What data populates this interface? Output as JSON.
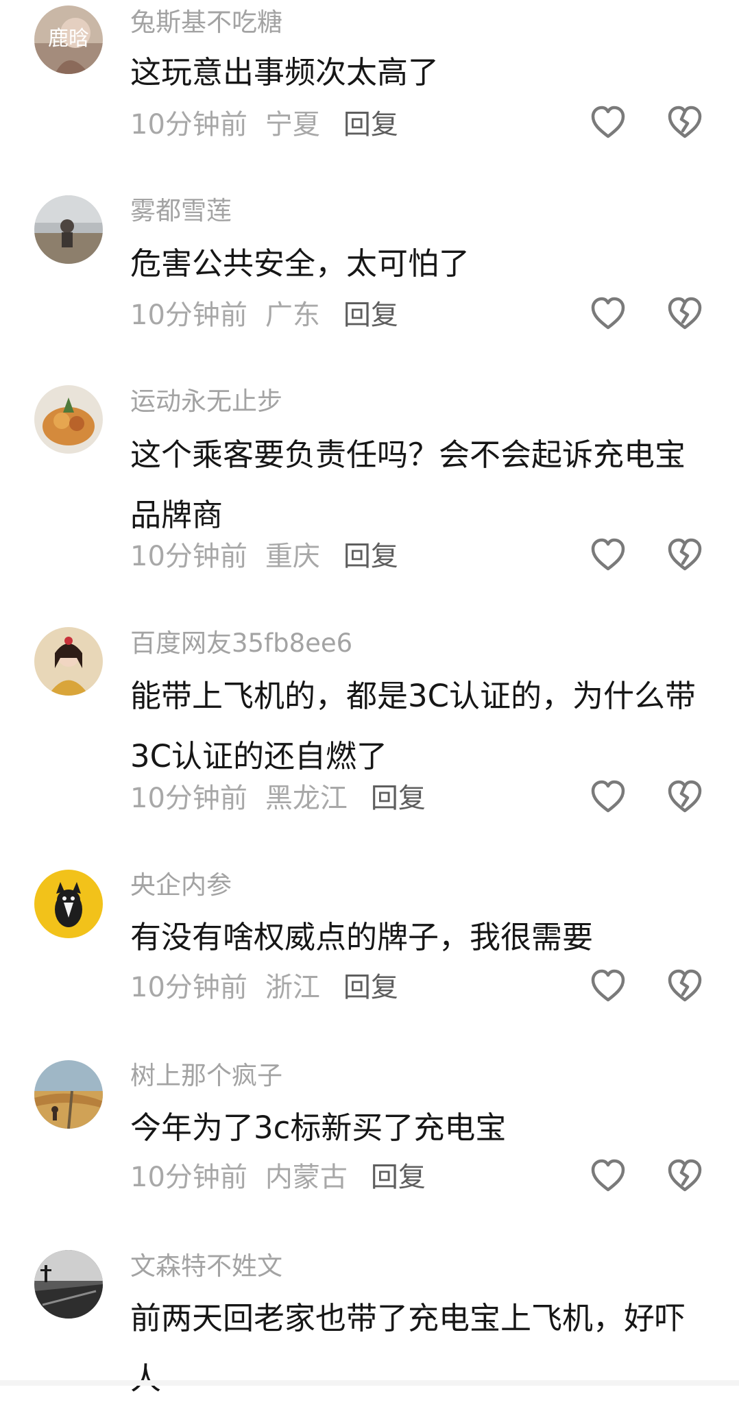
{
  "comments": [
    {
      "username": "兔斯基不吃糖",
      "avatar_text": "鹿晗",
      "text": "这玩意出事频次太高了",
      "time": "10分钟前",
      "location": "宁夏",
      "reply": "回复"
    },
    {
      "username": "雾都雪莲",
      "text": "危害公共安全，太可怕了",
      "time": "10分钟前",
      "location": "广东",
      "reply": "回复"
    },
    {
      "username": "运动永无止步",
      "text": "这个乘客要负责任吗？会不会起诉充电宝品牌商",
      "time": "10分钟前",
      "location": "重庆",
      "reply": "回复"
    },
    {
      "username": "百度网友35fb8ee6",
      "text": "能带上飞机的，都是3C认证的，为什么带3C认证的还自燃了",
      "time": "10分钟前",
      "location": "黑龙江",
      "reply": "回复"
    },
    {
      "username": "央企内参",
      "text": "有没有啥权威点的牌子，我很需要",
      "time": "10分钟前",
      "location": "浙江",
      "reply": "回复"
    },
    {
      "username": "树上那个疯子",
      "text": "今年为了3c标新买了充电宝",
      "time": "10分钟前",
      "location": "内蒙古",
      "reply": "回复"
    },
    {
      "username": "文森特不姓文",
      "text": "前两天回老家也带了充电宝上飞机，好吓人"
    }
  ],
  "icons": {
    "like": "heart-outline-icon",
    "dislike": "broken-heart-icon"
  },
  "colors": {
    "username": "#a3a3a3",
    "text": "#161616",
    "meta": "#a8a8a8",
    "reply": "#5e5e5e",
    "icon": "#7a7a7a"
  }
}
